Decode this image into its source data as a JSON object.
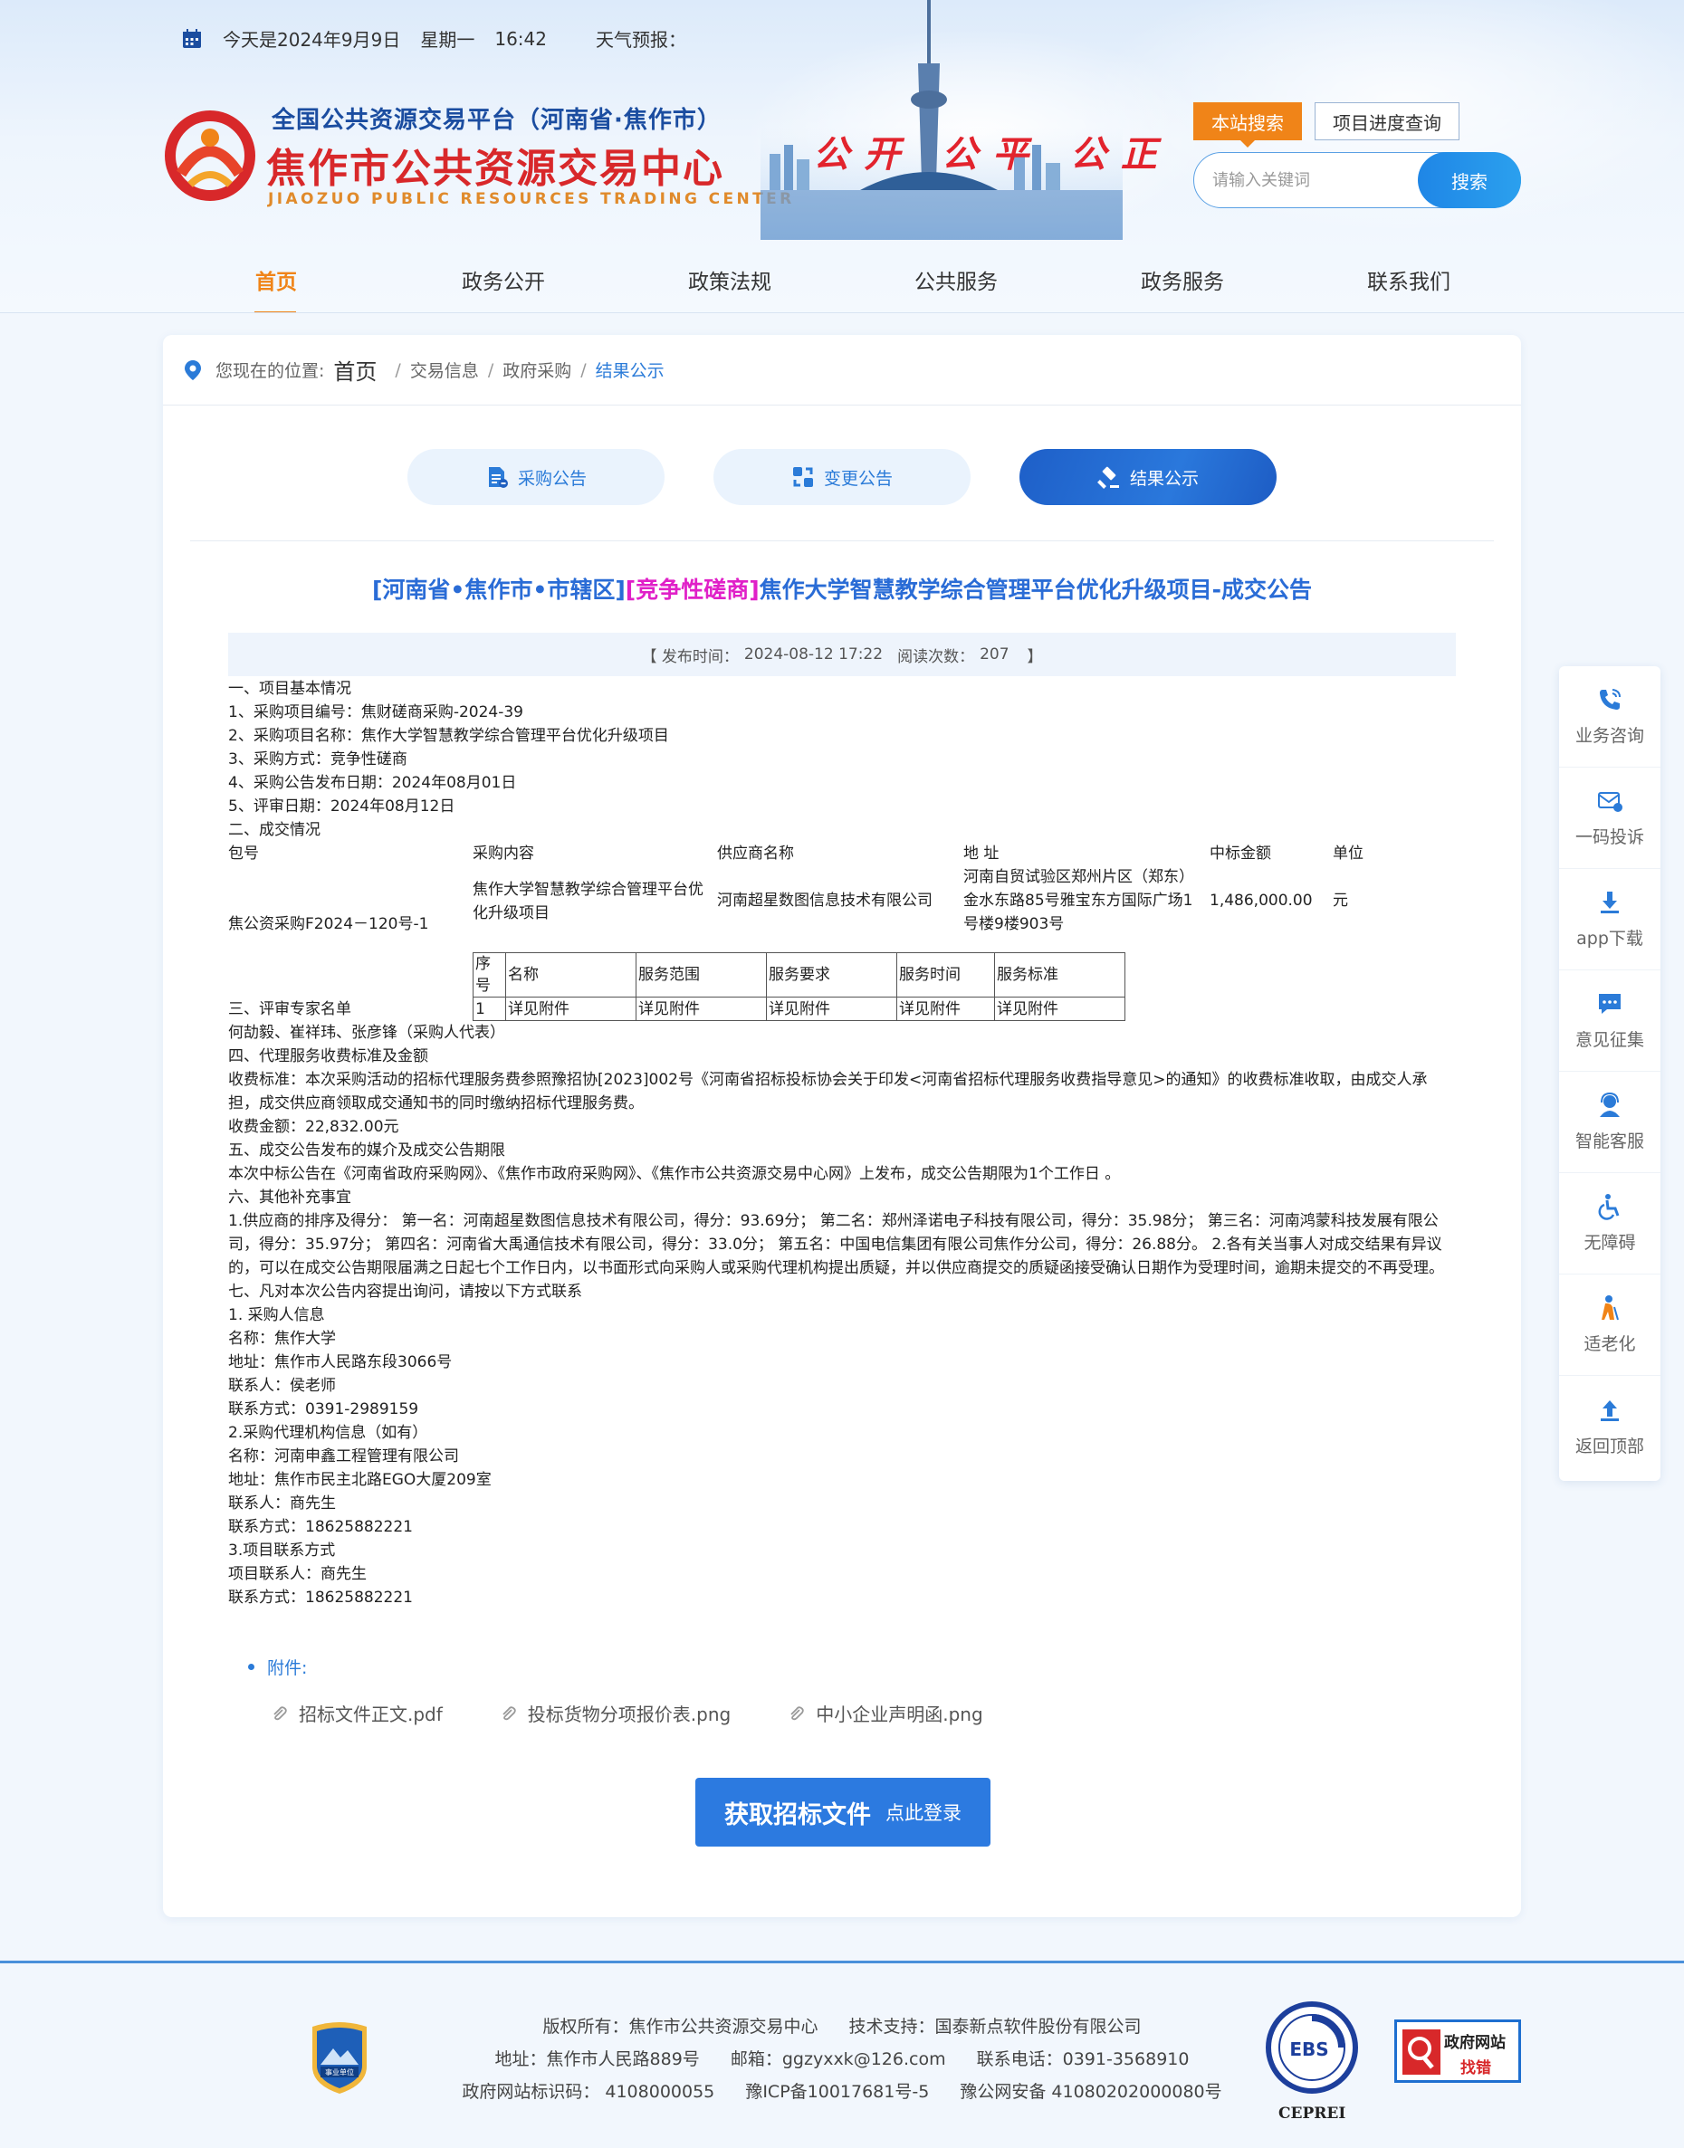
{
  "topbar": {
    "date": "今天是2024年9月9日",
    "weekday": "星期一",
    "time": "16:42",
    "weather": "天气预报："
  },
  "brand": {
    "subtitle": "全国公共资源交易平台（河南省·焦作市）",
    "name": "焦作市公共资源交易中心",
    "english": "JIAOZUO PUBLIC RESOURCES TRADING CENTER",
    "slogan": "公开 公平 公正"
  },
  "search": {
    "tab_site": "本站搜索",
    "tab_progress": "项目进度查询",
    "placeholder": "请输入关键词",
    "button": "搜索"
  },
  "nav": {
    "items": [
      "首页",
      "政务公开",
      "政策法规",
      "公共服务",
      "政务服务",
      "联系我们"
    ]
  },
  "breadcrumb": {
    "prefix": "您现在的位置:",
    "home": "首页",
    "level1": "交易信息",
    "level2": "政府采购",
    "current": "结果公示",
    "separator": "/"
  },
  "category_buttons": [
    "采购公告",
    "变更公告",
    "结果公示"
  ],
  "article": {
    "title_tag1": "[河南省•焦作市•市辖区]",
    "title_tag2": "[竞争性磋商]",
    "title_main": "焦作大学智慧教学综合管理平台优化升级项目-成交公告",
    "meta_open": "【 发布时间：",
    "publish_time": "2024-08-12 17:22",
    "meta_reads_label": "阅读次数：",
    "reads": "207",
    "meta_close": "】",
    "lines_top": [
      "一、项目基本情况",
      "1、采购项目编号：焦财磋商采购-2024-39",
      "2、采购项目名称：焦作大学智慧教学综合管理平台优化升级项目",
      "3、采购方式：竞争性磋商",
      "4、采购公告发布日期：2024年08月01日",
      "5、评审日期：2024年08月12日",
      "二、成交情况"
    ],
    "deal_table": {
      "headers": [
        "包号",
        "采购内容",
        "供应商名称",
        "地 址",
        "中标金额",
        "单位"
      ],
      "package": "焦公资采购F2024－120号-1",
      "content": "焦作大学智慧教学综合管理平台优化升级项目",
      "supplier": "河南超星数图信息技术有限公司",
      "address": "河南自贸试验区郑州片区（郑东）金水东路85号雅宝东方国际广场1号楼9楼903号",
      "amount": "1,486,000.00",
      "unit": "元",
      "sub_headers": [
        "序号",
        "名称",
        "服务范围",
        "服务要求",
        "服务时间",
        "服务标准"
      ],
      "sub_row": [
        "1",
        "详见附件",
        "详见附件",
        "详见附件",
        "详见附件",
        "详见附件"
      ]
    },
    "lines_bottom": [
      "三、评审专家名单",
      "何劼毅、崔祥玮、张彦锋（采购人代表）",
      "四、代理服务收费标准及金额",
      "收费标准：本次采购活动的招标代理服务费参照豫招协[2023]002号《河南省招标投标协会关于印发<河南省招标代理服务收费指导意见>的通知》的收费标准收取，由成交人承担，成交供应商领取成交通知书的同时缴纳招标代理服务费。",
      "收费金额：22,832.00元",
      "五、成交公告发布的媒介及成交公告期限",
      "本次中标公告在《河南省政府采购网》、《焦作市政府采购网》、《焦作市公共资源交易中心网》上发布，成交公告期限为1个工作日 。",
      "六、其他补充事宜",
      "1.供应商的排序及得分： 第一名：河南超星数图信息技术有限公司，得分：93.69分； 第二名：郑州泽诺电子科技有限公司，得分：35.98分； 第三名：河南鸿蒙科技发展有限公司，得分：35.97分； 第四名：河南省大禹通信技术有限公司，得分：33.0分； 第五名：中国电信集团有限公司焦作分公司，得分：26.88分。 2.各有关当事人对成交结果有异议的，可以在成交公告期限届满之日起七个工作日内，以书面形式向采购人或采购代理机构提出质疑，并以供应商提交的质疑函接受确认日期作为受理时间，逾期未提交的不再受理。",
      "七、凡对本次公告内容提出询问，请按以下方式联系",
      "1.  采购人信息",
      "名称：焦作大学",
      "地址：焦作市人民路东段3066号",
      "联系人：侯老师",
      "联系方式：0391-2989159",
      "2.采购代理机构信息（如有）",
      "名称：河南申鑫工程管理有限公司",
      "地址：焦作市民主北路EGO大厦209室",
      "联系人：商先生",
      "联系方式：18625882221",
      "3.项目联系方式",
      "项目联系人：商先生",
      "联系方式：18625882221"
    ],
    "attachments_label": "附件:",
    "attachments": [
      "招标文件正文.pdf",
      "投标货物分项报价表.png",
      "中小企业声明函.png"
    ],
    "get_button_big": "获取招标文件",
    "get_button_small": "点此登录"
  },
  "side_menu": [
    "业务咨询",
    "一码投诉",
    "app下载",
    "意见征集",
    "智能客服",
    "无障碍",
    "适老化",
    "返回顶部"
  ],
  "footer": {
    "copyright": "版权所有：焦作市公共资源交易中心",
    "support": "技术支持：国泰新点软件股份有限公司",
    "address": "地址：焦作市人民路889号",
    "email": "邮箱：ggzyxxk@126.com",
    "phone": "联系电话：0391-3568910",
    "site_id": "政府网站标识码： 4108000055",
    "icp": "豫ICP备10017681号-5",
    "police": "豫公网安备 41080202000080号",
    "badge_text": "事业单位",
    "cepre_text": "CEPREI",
    "cepre_mark": "EBS",
    "zfwz_line1": "政府网站",
    "zfwz_line2": "找错"
  },
  "colors": {
    "accent_orange": "#f08418",
    "link_blue": "#2b7bd8",
    "brand_red": "#d8282a",
    "title_blue": "#2a6cd6",
    "title_magenta": "#e020c8"
  }
}
